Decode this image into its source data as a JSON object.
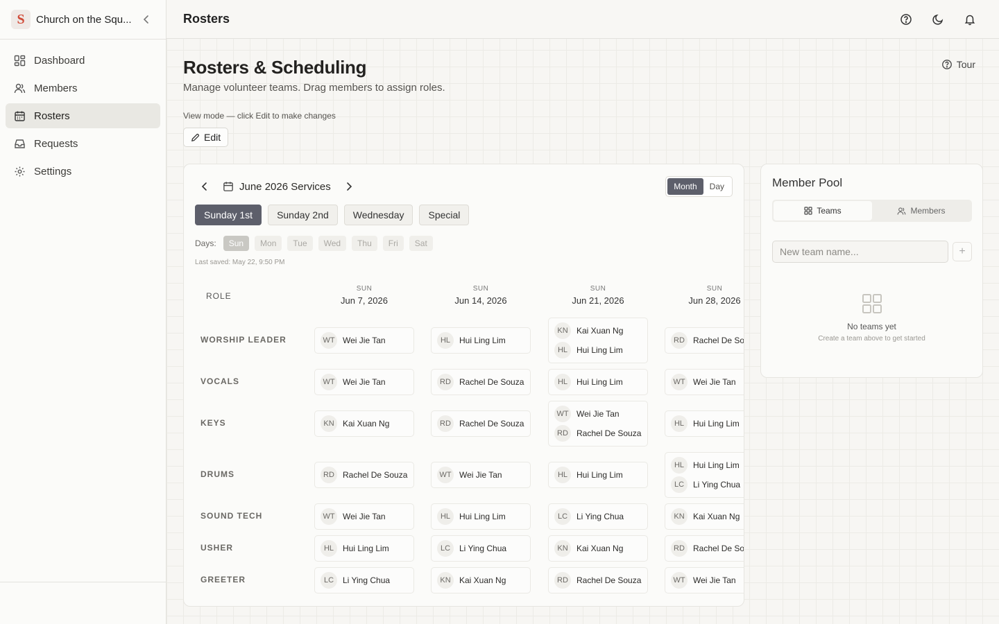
{
  "sidebar": {
    "org_name": "Church on the Squ...",
    "logo_letter": "S",
    "items": [
      {
        "label": "Dashboard",
        "icon": "dashboard-icon"
      },
      {
        "label": "Members",
        "icon": "users-icon"
      },
      {
        "label": "Rosters",
        "icon": "calendar-icon",
        "active": true
      },
      {
        "label": "Requests",
        "icon": "inbox-icon"
      },
      {
        "label": "Settings",
        "icon": "gear-icon"
      }
    ]
  },
  "topbar": {
    "title": "Rosters"
  },
  "header": {
    "title": "Rosters & Scheduling",
    "subtitle": "Manage volunteer teams. Drag members to assign roles.",
    "tour_label": "Tour",
    "view_mode_text": "View mode — click Edit to make changes",
    "edit_label": "Edit"
  },
  "roster": {
    "month_label": "June 2026 Services",
    "view_toggle": [
      "Month",
      "Day"
    ],
    "active_view": "Month",
    "service_tabs": [
      "Sunday 1st",
      "Sunday 2nd",
      "Wednesday",
      "Special"
    ],
    "active_service": "Sunday 1st",
    "days_label": "Days:",
    "days": [
      "Sun",
      "Mon",
      "Tue",
      "Wed",
      "Thu",
      "Fri",
      "Sat"
    ],
    "active_day": "Sun",
    "last_saved": "Last saved: May 22, 9:50 PM",
    "role_header": "ROLE",
    "columns": [
      {
        "dow": "SUN",
        "date": "Jun 7, 2026"
      },
      {
        "dow": "SUN",
        "date": "Jun 14, 2026"
      },
      {
        "dow": "SUN",
        "date": "Jun 21, 2026"
      },
      {
        "dow": "SUN",
        "date": "Jun 28, 2026"
      }
    ],
    "rows": [
      {
        "role": "WORSHIP LEADER",
        "cells": [
          [
            {
              "initials": "WT",
              "name": "Wei Jie Tan"
            }
          ],
          [
            {
              "initials": "HL",
              "name": "Hui Ling Lim"
            }
          ],
          [
            {
              "initials": "KN",
              "name": "Kai Xuan Ng"
            },
            {
              "initials": "HL",
              "name": "Hui Ling Lim"
            }
          ],
          [
            {
              "initials": "RD",
              "name": "Rachel De Souza"
            }
          ]
        ]
      },
      {
        "role": "VOCALS",
        "cells": [
          [
            {
              "initials": "WT",
              "name": "Wei Jie Tan"
            }
          ],
          [
            {
              "initials": "RD",
              "name": "Rachel De Souza"
            }
          ],
          [
            {
              "initials": "HL",
              "name": "Hui Ling Lim"
            }
          ],
          [
            {
              "initials": "WT",
              "name": "Wei Jie Tan"
            }
          ]
        ]
      },
      {
        "role": "KEYS",
        "cells": [
          [
            {
              "initials": "KN",
              "name": "Kai Xuan Ng"
            }
          ],
          [
            {
              "initials": "RD",
              "name": "Rachel De Souza"
            }
          ],
          [
            {
              "initials": "WT",
              "name": "Wei Jie Tan"
            },
            {
              "initials": "RD",
              "name": "Rachel De Souza"
            }
          ],
          [
            {
              "initials": "HL",
              "name": "Hui Ling Lim"
            }
          ]
        ]
      },
      {
        "role": "DRUMS",
        "cells": [
          [
            {
              "initials": "RD",
              "name": "Rachel De Souza"
            }
          ],
          [
            {
              "initials": "WT",
              "name": "Wei Jie Tan"
            }
          ],
          [
            {
              "initials": "HL",
              "name": "Hui Ling Lim"
            }
          ],
          [
            {
              "initials": "HL",
              "name": "Hui Ling Lim"
            },
            {
              "initials": "LC",
              "name": "Li Ying Chua"
            }
          ]
        ]
      },
      {
        "role": "SOUND TECH",
        "cells": [
          [
            {
              "initials": "WT",
              "name": "Wei Jie Tan"
            }
          ],
          [
            {
              "initials": "HL",
              "name": "Hui Ling Lim"
            }
          ],
          [
            {
              "initials": "LC",
              "name": "Li Ying Chua"
            }
          ],
          [
            {
              "initials": "KN",
              "name": "Kai Xuan Ng"
            }
          ]
        ]
      },
      {
        "role": "USHER",
        "cells": [
          [
            {
              "initials": "HL",
              "name": "Hui Ling Lim"
            }
          ],
          [
            {
              "initials": "LC",
              "name": "Li Ying Chua"
            }
          ],
          [
            {
              "initials": "KN",
              "name": "Kai Xuan Ng"
            }
          ],
          [
            {
              "initials": "RD",
              "name": "Rachel De Souza"
            }
          ]
        ]
      },
      {
        "role": "GREETER",
        "cells": [
          [
            {
              "initials": "LC",
              "name": "Li Ying Chua"
            }
          ],
          [
            {
              "initials": "KN",
              "name": "Kai Xuan Ng"
            }
          ],
          [
            {
              "initials": "RD",
              "name": "Rachel De Souza"
            }
          ],
          [
            {
              "initials": "WT",
              "name": "Wei Jie Tan"
            }
          ]
        ]
      }
    ]
  },
  "pool": {
    "title": "Member Pool",
    "tabs": [
      "Teams",
      "Members"
    ],
    "active_tab": "Teams",
    "new_team_placeholder": "New team name...",
    "add_label": "+",
    "empty_title": "No teams yet",
    "empty_sub": "Create a team above to get started"
  },
  "colors": {
    "accent": "#5d5f6b",
    "brand": "#d04a37",
    "background": "#f7f6f3"
  }
}
